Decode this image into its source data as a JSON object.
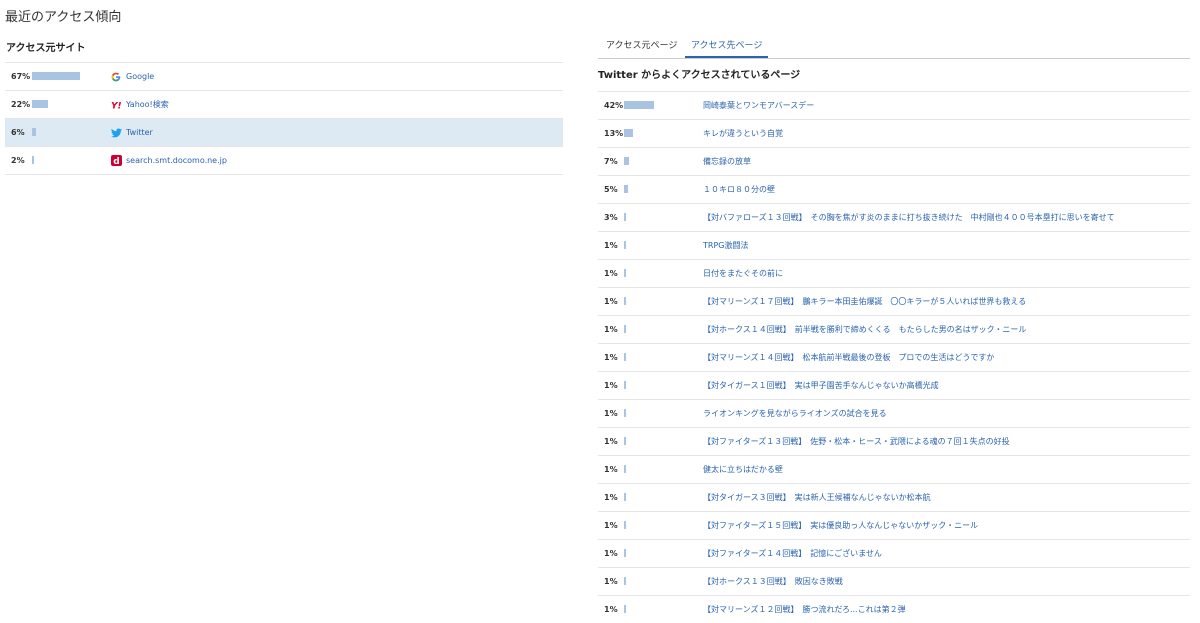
{
  "page_title": "最近のアクセス傾向",
  "left": {
    "section_title": "アクセス元サイト",
    "rows": [
      {
        "pct": "67%",
        "value": 67,
        "site": "Google",
        "icon": "google-icon",
        "selected": false
      },
      {
        "pct": "22%",
        "value": 22,
        "site": "Yahoo!検索",
        "icon": "yahoo-icon",
        "selected": false
      },
      {
        "pct": "6%",
        "value": 6,
        "site": "Twitter",
        "icon": "twitter-icon",
        "selected": true
      },
      {
        "pct": "2%",
        "value": 2,
        "site": "search.smt.docomo.ne.jp",
        "icon": "docomo-icon",
        "selected": false
      }
    ]
  },
  "right": {
    "tabs": [
      "アクセス元ページ",
      "アクセス先ページ"
    ],
    "active_tab": 1,
    "title": "Twitter からよくアクセスされているページ",
    "rows": [
      {
        "pct": "42%",
        "value": 42,
        "label": "岡崎泰葉とワンモアバースデー"
      },
      {
        "pct": "13%",
        "value": 13,
        "label": "キレが違うという自覚"
      },
      {
        "pct": "7%",
        "value": 7,
        "label": "備忘録の放草"
      },
      {
        "pct": "5%",
        "value": 5,
        "label": "１０キロ８０分の壁"
      },
      {
        "pct": "3%",
        "value": 3,
        "label": "【対バファローズ１３回戦】　その胸を焦がす炎のままに打ち抜き続けた　中村剛也４００号本塁打に思いを寄せて"
      },
      {
        "pct": "1%",
        "value": 1,
        "label": "TRPG激闘法"
      },
      {
        "pct": "1%",
        "value": 1,
        "label": "日付をまたぐその前に"
      },
      {
        "pct": "1%",
        "value": 1,
        "label": "【対マリーンズ１７回戦】　鵬キラー本田圭佑爆誕　〇〇キラーが５人いれば世界も救える"
      },
      {
        "pct": "1%",
        "value": 1,
        "label": "【対ホークス１４回戦】　前半戦を勝利で締めくくる　もたらした男の名はザック・ニール"
      },
      {
        "pct": "1%",
        "value": 1,
        "label": "【対マリーンズ１４回戦】　松本航前半戦最後の登板　プロでの生活はどうですか"
      },
      {
        "pct": "1%",
        "value": 1,
        "label": "【対タイガース１回戦】　実は甲子園苦手なんじゃないか高橋光成"
      },
      {
        "pct": "1%",
        "value": 1,
        "label": "ライオンキングを見ながらライオンズの試合を見る"
      },
      {
        "pct": "1%",
        "value": 1,
        "label": "【対ファイターズ１３回戦】　佐野・松本・ヒース・武隈による魂の７回１失点の好投"
      },
      {
        "pct": "1%",
        "value": 1,
        "label": "健太に立ちはだかる壁"
      },
      {
        "pct": "1%",
        "value": 1,
        "label": "【対タイガース３回戦】　実は新人王候補なんじゃないか松本航"
      },
      {
        "pct": "1%",
        "value": 1,
        "label": "【対ファイターズ１５回戦】　実は優良助っ人なんじゃないかザック・ニール"
      },
      {
        "pct": "1%",
        "value": 1,
        "label": "【対ファイターズ１４回戦】　記憶にございません"
      },
      {
        "pct": "1%",
        "value": 1,
        "label": "【対ホークス１３回戦】　敗因なき敗戦"
      },
      {
        "pct": "1%",
        "value": 1,
        "label": "【対マリーンズ１２回戦】　勝つ流れだろ...これは第２弾"
      }
    ]
  },
  "colors": {
    "bar": "#a9c4e3",
    "link": "#2a63b0",
    "selected_bg": "#ddeaf3"
  }
}
